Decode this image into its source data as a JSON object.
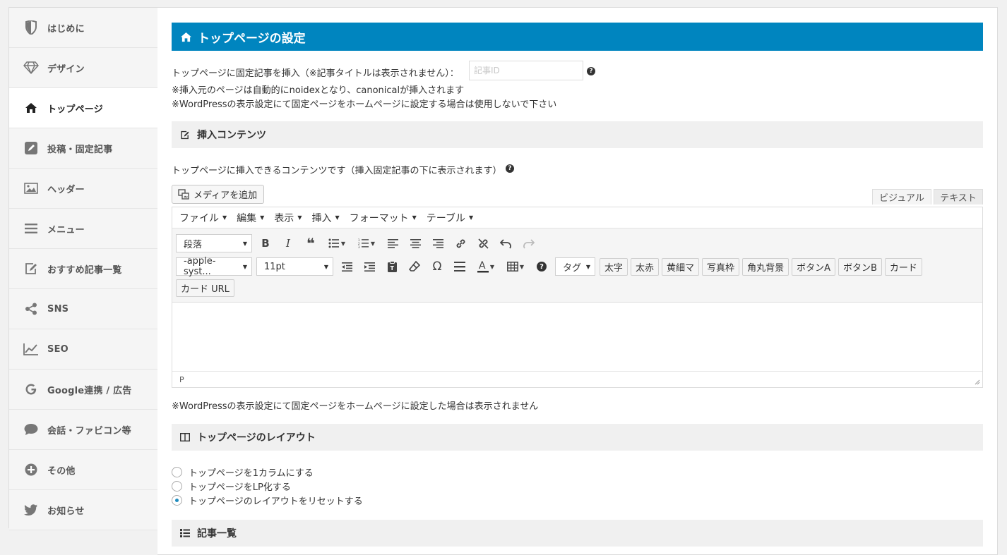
{
  "sidebar": {
    "items": [
      {
        "label": "はじめに",
        "icon": "shield-half-icon"
      },
      {
        "label": "デザイン",
        "icon": "diamond-icon"
      },
      {
        "label": "トップページ",
        "icon": "home-icon"
      },
      {
        "label": "投稿・固定記事",
        "icon": "edit-square-icon"
      },
      {
        "label": "ヘッダー",
        "icon": "image-icon"
      },
      {
        "label": "メニュー",
        "icon": "bars-icon"
      },
      {
        "label": "おすすめ記事一覧",
        "icon": "external-edit-icon"
      },
      {
        "label": "SNS",
        "icon": "share-icon"
      },
      {
        "label": "SEO",
        "icon": "line-chart-icon"
      },
      {
        "label": "Google連携 / 広告",
        "icon": "google-icon"
      },
      {
        "label": "会話・ファビコン等",
        "icon": "comment-icon"
      },
      {
        "label": "その他",
        "icon": "plus-circle-icon"
      },
      {
        "label": "お知らせ",
        "icon": "twitter-icon"
      }
    ],
    "active_index": 2
  },
  "main": {
    "title": "トップページの設定",
    "insert_label": "トップページに固定記事を挿入（※記事タイトルは表示されません）：",
    "insert_placeholder": "記事ID",
    "note1": "※挿入元のページは自動的にnoidexとなり、canonicalが挿入されます",
    "note2": "※WordPressの表示設定にて固定ページをホームページに設定する場合は使用しないで下さい",
    "section_insert": "挿入コンテンツ",
    "insert_desc": "トップページに挿入できるコンテンツです（挿入固定記事の下に表示されます）",
    "media_button": "メディアを追加",
    "tab_visual": "ビジュアル",
    "tab_text": "テキスト",
    "editor_note": "※WordPressの表示設定にて固定ページをホームページに設定した場合は表示されません",
    "section_layout": "トップページのレイアウト",
    "radios": [
      {
        "label": "トップページを1カラムにする",
        "checked": false
      },
      {
        "label": "トップページをLP化する",
        "checked": false
      },
      {
        "label": "トップページのレイアウトをリセットする",
        "checked": true
      }
    ],
    "section_list": "記事一覧"
  },
  "editor": {
    "menus": [
      "ファイル",
      "編集",
      "表示",
      "挿入",
      "フォーマット",
      "テーブル"
    ],
    "format_select": "段落",
    "font_select": "-apple-syst...",
    "size_select": "11pt",
    "tag_select": "タグ",
    "custom_buttons": [
      "太字",
      "太赤",
      "黄細マ",
      "写真枠",
      "角丸背景",
      "ボタンA",
      "ボタンB",
      "カード"
    ],
    "card_url_button": "カード URL",
    "status_path": "P"
  },
  "colors": {
    "accent": "#0085bf",
    "section_bg": "#f0f0f0",
    "radio_checked": "#1e8cbe"
  }
}
